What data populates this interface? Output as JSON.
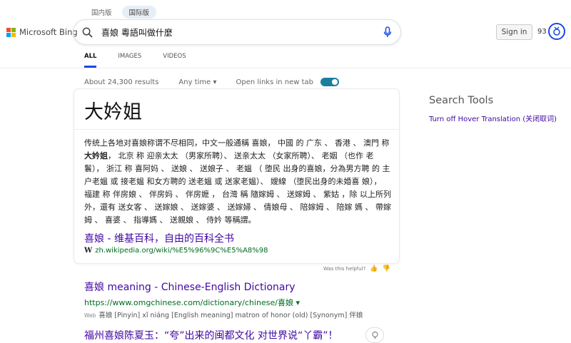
{
  "region_tabs": [
    "国内版",
    "国际版"
  ],
  "brand": {
    "name": "Microsoft Bing"
  },
  "search": {
    "query": "喜娘 粵語叫做什麼"
  },
  "header": {
    "signin_label": "Sign in",
    "rewards_count": "93"
  },
  "scopes": [
    "ALL",
    "IMAGES",
    "VIDEOS"
  ],
  "results_meta": {
    "count": "About 24,300 results",
    "anytime": "Any time",
    "open_links": "Open links in new tab",
    "open_links_on": true
  },
  "answer": {
    "title": "大妗姐",
    "body_segments": [
      {
        "text": "传统上各地对喜娘称谓不尽相同，中文一般通稱 喜娘， 中國 的 广东 、 香港 、 澳門 称 ",
        "bold": false
      },
      {
        "text": "大妗姐",
        "bold": true
      },
      {
        "text": "， 北京 称 迎亲太太 （男家所聘）、 送亲太太 （女家所聘）、 老姻 （也作 老鬟）， 浙江 称 喜阿妈 、 送娘 、 送娘子 、 老媪 （ 堕民 出身的喜娘，分為男方聘 的 主户老媪 或 接老媪 和女方聘的 送老媪 或 送家老媪）、 嬡線 （堕民出身的未婚喜 娘）， 福建 称 伴房娘 、 伴房妈 、 伴房嬷 ， 台灣 稱 隨嫁姆 、 送嫁姆 、 紫姑 ，除 以上所列外，還有 送女客 、 送嫁娘 、 送嫁婆 、 送嫁婦 、 倩娘母 、 陪嫁姆 、 陪嫁 媽 、 帶嫁姆 、 喜婆 、 指導媽 、 送親娘 、 侍妗 等稱謂。",
        "bold": false
      }
    ],
    "link_title": "喜娘 - 维基百科，自由的百科全书",
    "link_icon": "W",
    "link_url": "zh.wikipedia.org/wiki/%E5%96%9C%E5%A8%98",
    "helpful_label": "Was this helpful?"
  },
  "results": [
    {
      "title": "喜娘 meaning - Chinese-English Dictionary",
      "url": "https://www.omgchinese.com/dictionary/chinese/喜娘",
      "web_label": "Web",
      "snippet": "喜娘 [Pinyin] xǐ niáng [English meaning] matron of honor (old) [Synonym] 伴娘"
    },
    {
      "title": "福州喜娘陈夏玉：“夸”出来的闽都文化 对世界说“丫霸”！",
      "url": "",
      "web_label": "",
      "snippet": ""
    }
  ],
  "sidebar": {
    "title": "Search Tools",
    "link": "Turn off Hover Translation (关闭取词)"
  },
  "colors": {
    "accent": "#174ae4",
    "link": "#4007a2",
    "url": "#006d21",
    "toggle": "#1a7f9c"
  },
  "icons": {
    "search": "search-icon",
    "mic": "microphone-icon",
    "rewards": "rewards-medal-icon",
    "bulb": "lightbulb-icon"
  }
}
